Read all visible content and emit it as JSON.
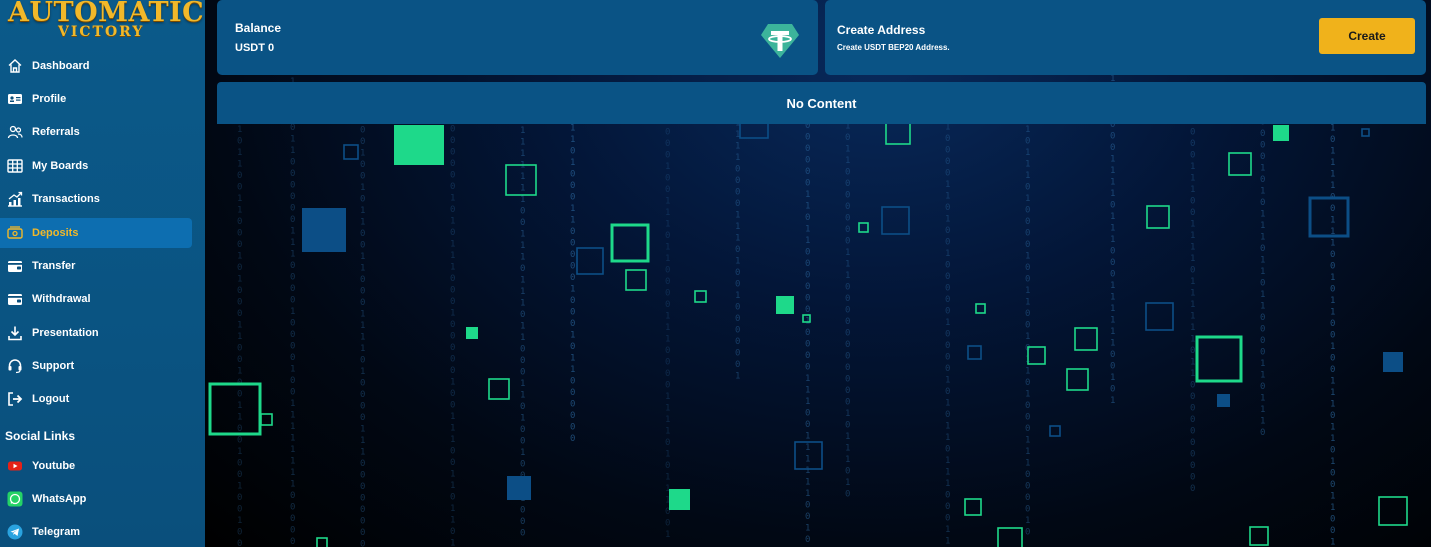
{
  "brand": {
    "line1": "AUTOMATIC",
    "line2": "VICTORY"
  },
  "sidebar": {
    "items": [
      {
        "label": "Dashboard",
        "icon": "home-icon"
      },
      {
        "label": "Profile",
        "icon": "id-card-icon"
      },
      {
        "label": "Referrals",
        "icon": "users-icon"
      },
      {
        "label": "My Boards",
        "icon": "grid-icon"
      },
      {
        "label": "Transactions",
        "icon": "chart-icon"
      },
      {
        "label": "Deposits",
        "icon": "deposit-icon",
        "active": true
      },
      {
        "label": "Transfer",
        "icon": "wallet-icon"
      },
      {
        "label": "Withdrawal",
        "icon": "wallet-icon"
      },
      {
        "label": "Presentation",
        "icon": "download-icon"
      },
      {
        "label": "Support",
        "icon": "headset-icon"
      },
      {
        "label": "Logout",
        "icon": "logout-icon"
      }
    ],
    "social_title": "Social Links",
    "social": [
      {
        "label": "Youtube",
        "icon": "youtube-icon"
      },
      {
        "label": "WhatsApp",
        "icon": "whatsapp-icon"
      },
      {
        "label": "Telegram",
        "icon": "telegram-icon"
      }
    ]
  },
  "balance": {
    "title": "Balance",
    "value": "USDT 0",
    "icon": "tether-icon"
  },
  "create_address": {
    "title": "Create Address",
    "subtitle": "Create USDT BEP20 Address.",
    "button": "Create"
  },
  "empty_state": "No Content",
  "colors": {
    "accent": "#f0b21b",
    "sidebar": "#0a4f7c",
    "card": "#0a5385",
    "green": "#1ed98a"
  }
}
